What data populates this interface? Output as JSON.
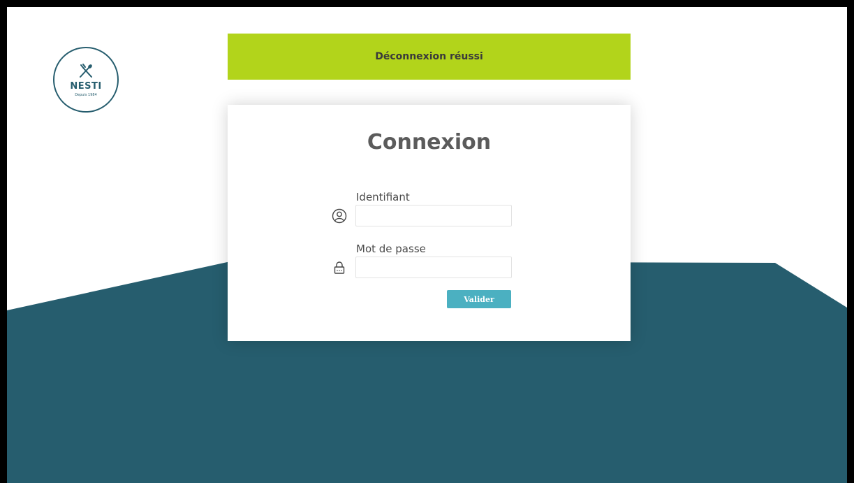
{
  "brand": {
    "name": "NESTI",
    "since": "Depuis 1984",
    "color": "#265d6e"
  },
  "alert": {
    "message": "Déconnexion réussi",
    "color": "#b2d41b"
  },
  "login": {
    "title": "Connexion",
    "username_label": "Identifiant",
    "username_value": "",
    "password_label": "Mot de passe",
    "password_value": "",
    "submit_label": "Valider",
    "submit_color": "#4bb0c1"
  },
  "icons": {
    "logo": "fork-spoon-icon",
    "username": "user-icon",
    "password": "lock-icon"
  },
  "background": {
    "wave_color": "#265d6e"
  }
}
